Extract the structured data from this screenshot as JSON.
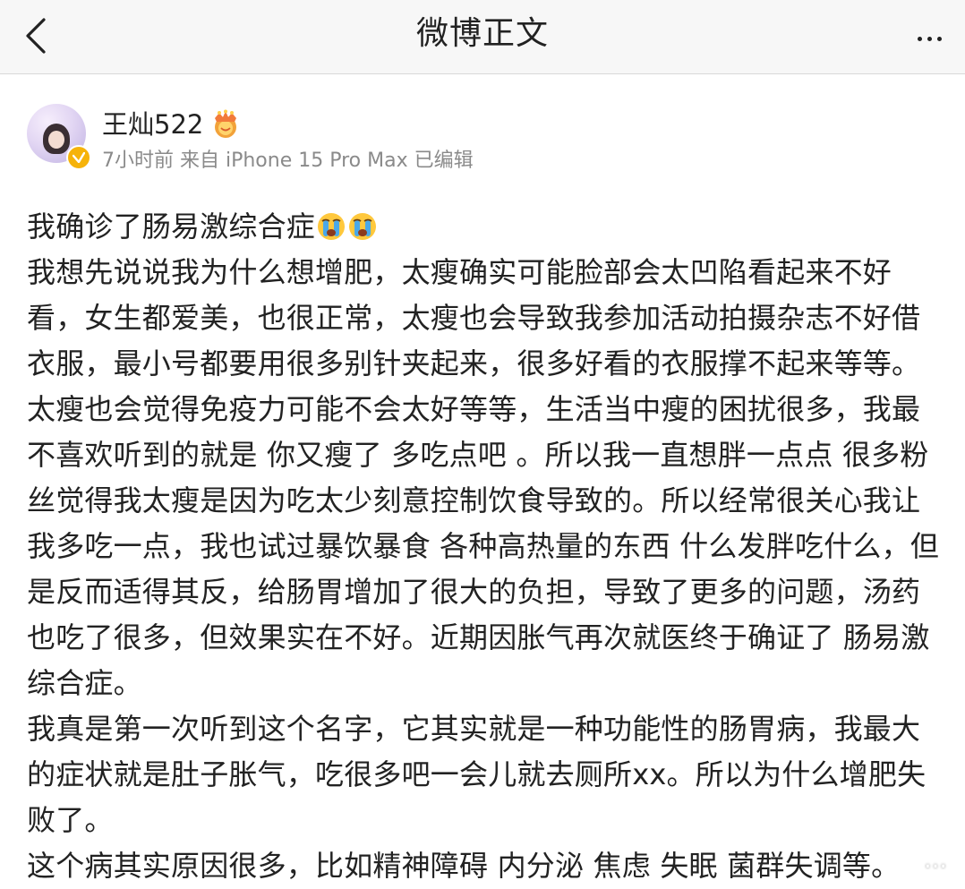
{
  "header": {
    "title": "微博正文",
    "back_icon": "back-chevron-icon",
    "more_icon": "more-dots-icon"
  },
  "post": {
    "author": "王灿522",
    "meta": "7小时前 来自 iPhone 15 Pro Max 已编辑",
    "paragraphs": [
      "我确诊了肠易激综合症",
      "我想先说说我为什么想增肥，太瘦确实可能脸部会太凹陷看起来不好看，女生都爱美，也很正常，太瘦也会导致我参加活动拍摄杂志不好借衣服，最小号都要用很多别针夹起来，很多好看的衣服撑不起来等等。太瘦也会觉得免疫力可能不会太好等等，生活当中瘦的困扰很多，我最不喜欢听到的就是 你又瘦了 多吃点吧 。所以我一直想胖一点点 很多粉丝觉得我太瘦是因为吃太少刻意控制饮食导致的。所以经常很关心我让我多吃一点，我也试过暴饮暴食 各种高热量的东西 什么发胖吃什么，但是反而适得其反，给肠胃增加了很大的负担，导致了更多的问题，汤药也吃了很多，但效果实在不好。近期因胀气再次就医终于确证了 肠易激综合症。",
      "我真是第一次听到这个名字，它其实就是一种功能性的肠胃病，我最大的症状就是肚子胀气，吃很多吧一会儿就去厕所xx。所以为什么增肥失败了。",
      "这个病其实原因很多，比如精神障碍 内分泌 焦虑 失眠 菌群失调等。"
    ],
    "watermark": "…",
    "icons": [
      "avatar",
      "verified-badge-icon",
      "crown-icon",
      "crying-face-icon"
    ]
  },
  "colors": {
    "header_bg": "#f7f7f7",
    "text": "#222222",
    "meta": "#8a8a8a",
    "badge": "#f6b30a"
  }
}
